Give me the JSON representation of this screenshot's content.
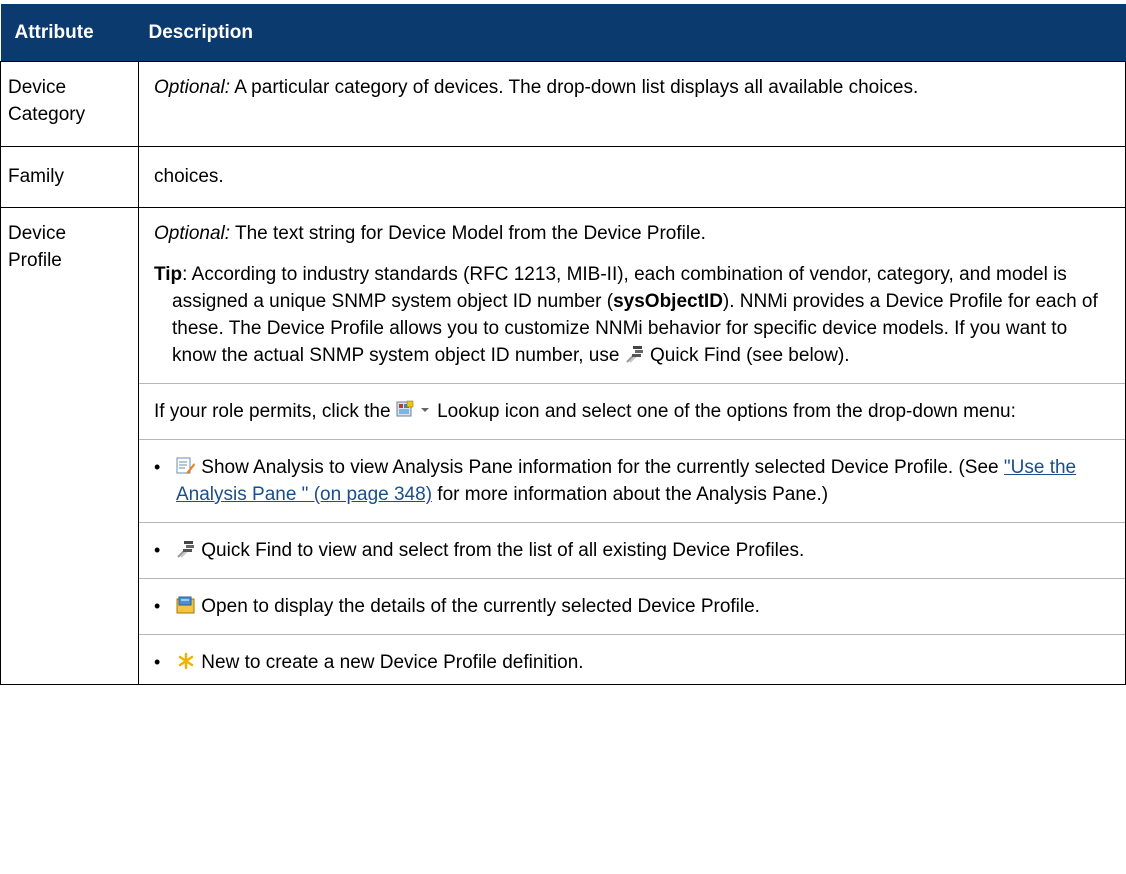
{
  "header": {
    "col1": "Attribute",
    "col2": "Description"
  },
  "rows": {
    "device_category": {
      "attr_line1": "Device",
      "attr_line2": "Category",
      "optional": "Optional:",
      "text": " A particular category of devices. The drop-down list displays all available choices."
    },
    "family": {
      "attr": "Family",
      "text": "choices."
    },
    "device_profile": {
      "attr_line1": "Device",
      "attr_line2": "Profile",
      "optional": "Optional:",
      "text": " The text string for Device Model from the Device Profile.",
      "tip_label": "Tip",
      "tip_text_1": ": According to industry standards (RFC 1213, MIB-II), each combination of vendor, category, and model is assigned a unique SNMP system object ID number (",
      "tip_bold": "sysObjectID",
      "tip_text_2": "). NNMi provides a Device Profile for each of these. The Device Profile allows you to customize NNMi behavior for specific device models. If you want to know the actual SNMP system object ID number, use ",
      "tip_text_3": " Quick Find (see below).",
      "role_text_1": "If your role permits, click the ",
      "role_text_2": " Lookup icon and select one of the options from the drop-down menu:",
      "options": {
        "show_analysis_1": " Show Analysis to view Analysis Pane information for the currently selected Device Profile. (See ",
        "show_analysis_link": "\"Use the Analysis Pane \" (on page 348)",
        "show_analysis_2": " for more information about the Analysis Pane.)",
        "quick_find": " Quick Find to view and select from the list of all existing Device Profiles.",
        "open": " Open to display the details of the currently selected Device Profile.",
        "new": " New to create a new Device Profile definition."
      },
      "bullet": "•"
    }
  },
  "icons": {
    "quick_find": "quick-find-icon",
    "lookup": "lookup-icon",
    "show_analysis": "show-analysis-icon",
    "open": "open-icon",
    "new": "new-icon",
    "dropdown": "dropdown-arrow-icon"
  },
  "colors": {
    "header_bg": "#0b3a6e",
    "link": "#1a4f8b"
  }
}
